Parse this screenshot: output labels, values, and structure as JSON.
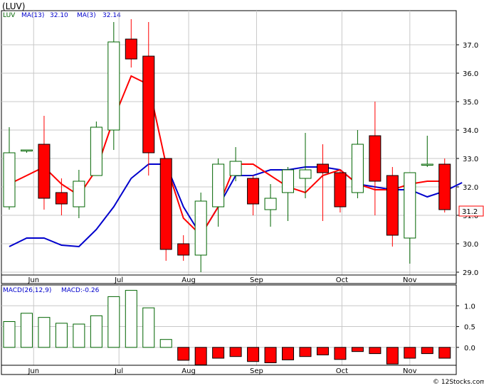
{
  "title": "(LUV)",
  "watermark": "© 12Stocks.com",
  "legend": {
    "symbol": "LUV",
    "ma13_label": "MA(13)",
    "ma13_value": "32.10",
    "ma3_label": "MA(3)",
    "ma3_value": "32.14",
    "macd_label": "MACD(26,12,9)",
    "macd_value_label": "MACD:-0.26"
  },
  "colors": {
    "up_candle": "#006400",
    "down_candle": "#ff0000",
    "ma13": "#0000cc",
    "ma3": "#ff0000",
    "macd_pos": "#006400",
    "macd_neg": "#ff0000",
    "grid": "#c8c8c8",
    "price_tag_border": "#ff0000"
  },
  "last_price_label": "31.2",
  "chart_data": [
    {
      "type": "candlestick",
      "panel": "price",
      "ylim": [
        28.9,
        38.2
      ],
      "yticks": [
        "29.0",
        "30.0",
        "31.0",
        "32.0",
        "33.0",
        "34.0",
        "35.0",
        "36.0",
        "37.0"
      ],
      "xticks": [
        {
          "label": "Jun",
          "index": 1.4
        },
        {
          "label": "Jul",
          "index": 6.3
        },
        {
          "label": "Aug",
          "index": 10.3
        },
        {
          "label": "Sep",
          "index": 14.2
        },
        {
          "label": "Oct",
          "index": 19.1
        },
        {
          "label": "Nov",
          "index": 23.0
        }
      ],
      "candles": [
        {
          "o": 31.3,
          "h": 34.1,
          "l": 31.2,
          "c": 33.2
        },
        {
          "o": 33.3,
          "h": 33.3,
          "l": 33.2,
          "c": 33.3
        },
        {
          "o": 33.5,
          "h": 34.5,
          "l": 31.2,
          "c": 31.6
        },
        {
          "o": 31.8,
          "h": 32.3,
          "l": 31.0,
          "c": 31.4
        },
        {
          "o": 31.3,
          "h": 32.6,
          "l": 30.9,
          "c": 32.2
        },
        {
          "o": 32.4,
          "h": 34.3,
          "l": 32.4,
          "c": 34.1
        },
        {
          "o": 34.0,
          "h": 37.8,
          "l": 33.3,
          "c": 37.1
        },
        {
          "o": 37.2,
          "h": 37.9,
          "l": 36.2,
          "c": 36.5
        },
        {
          "o": 36.6,
          "h": 37.8,
          "l": 32.4,
          "c": 33.2
        },
        {
          "o": 33.0,
          "h": 33.0,
          "l": 29.4,
          "c": 29.8
        },
        {
          "o": 30.0,
          "h": 30.3,
          "l": 29.4,
          "c": 29.6
        },
        {
          "o": 29.6,
          "h": 31.8,
          "l": 29.0,
          "c": 31.5
        },
        {
          "o": 31.3,
          "h": 33.0,
          "l": 30.6,
          "c": 32.8
        },
        {
          "o": 32.4,
          "h": 33.4,
          "l": 32.2,
          "c": 32.9
        },
        {
          "o": 32.3,
          "h": 32.4,
          "l": 31.0,
          "c": 31.4
        },
        {
          "o": 31.2,
          "h": 32.1,
          "l": 30.6,
          "c": 31.6
        },
        {
          "o": 31.8,
          "h": 32.7,
          "l": 30.8,
          "c": 32.6
        },
        {
          "o": 32.3,
          "h": 33.9,
          "l": 31.6,
          "c": 32.6
        },
        {
          "o": 32.8,
          "h": 33.5,
          "l": 30.8,
          "c": 32.5
        },
        {
          "o": 32.5,
          "h": 32.6,
          "l": 31.1,
          "c": 31.3
        },
        {
          "o": 31.8,
          "h": 34.0,
          "l": 31.6,
          "c": 33.5
        },
        {
          "o": 33.8,
          "h": 35.0,
          "l": 31.0,
          "c": 32.2
        },
        {
          "o": 32.4,
          "h": 32.7,
          "l": 29.9,
          "c": 30.3
        },
        {
          "o": 30.2,
          "h": 32.5,
          "l": 29.3,
          "c": 32.5
        },
        {
          "o": 32.8,
          "h": 33.8,
          "l": 32.7,
          "c": 32.8
        },
        {
          "o": 32.8,
          "h": 33.0,
          "l": 31.1,
          "c": 31.2
        }
      ],
      "series": [
        {
          "name": "MA(13)",
          "values": [
            29.9,
            30.2,
            30.2,
            29.95,
            29.9,
            30.5,
            31.3,
            32.3,
            32.8,
            32.8,
            31.3,
            30.3,
            31.3,
            32.4,
            32.4,
            32.6,
            32.6,
            32.7,
            32.7,
            32.6,
            32.1,
            32.0,
            31.9,
            31.9,
            31.65,
            31.85,
            32.15
          ]
        },
        {
          "name": "MA(3)",
          "values": [
            32.1,
            32.4,
            32.7,
            32.1,
            31.7,
            32.6,
            34.4,
            35.9,
            35.6,
            32.8,
            30.9,
            30.3,
            31.3,
            32.8,
            32.8,
            32.4,
            32.0,
            31.8,
            32.4,
            32.6,
            32.1,
            31.9,
            31.9,
            32.1,
            32.2,
            32.2
          ]
        }
      ]
    },
    {
      "type": "bar",
      "panel": "macd",
      "ylim": [
        -0.43,
        1.5
      ],
      "yticks": [
        "0.0",
        "0.5",
        "1.0"
      ],
      "xticks": [
        {
          "label": "Jun",
          "index": 1.4
        },
        {
          "label": "Jul",
          "index": 6.3
        },
        {
          "label": "Aug",
          "index": 10.3
        },
        {
          "label": "Sep",
          "index": 14.2
        },
        {
          "label": "Oct",
          "index": 19.1
        },
        {
          "label": "Nov",
          "index": 23.0
        }
      ],
      "values": [
        0.62,
        0.82,
        0.72,
        0.58,
        0.56,
        0.76,
        1.22,
        1.37,
        0.95,
        0.19,
        -0.31,
        -0.42,
        -0.26,
        -0.22,
        -0.34,
        -0.37,
        -0.3,
        -0.22,
        -0.18,
        -0.29,
        -0.1,
        -0.15,
        -0.4,
        -0.26,
        -0.15,
        -0.26
      ]
    }
  ]
}
